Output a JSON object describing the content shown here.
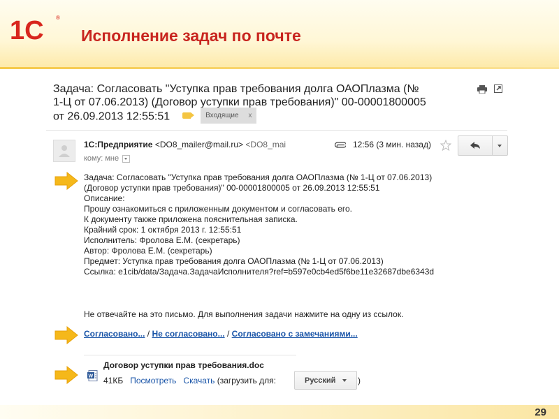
{
  "slide": {
    "title": "Исполнение задач по почте",
    "page_number": "29",
    "logo_text": "1С"
  },
  "email": {
    "subject_line1": "Задача: Согласовать \"Уступка прав требования долга ОАОПлазма (№",
    "subject_line2": "1-Ц от 07.06.2013) (Договор уступки прав требования)\" 00-00001800005",
    "subject_line3": "от 26.09.2013 12:55:51",
    "folder_label": "Входящие",
    "folder_remove": "x",
    "sender_name": "1С:Предприятие",
    "sender_email": "<DO8_mailer@mail.ru>",
    "sender_email_short": "<DO8_mai",
    "to_line": "кому: мне",
    "time": "12:56 (3 мин. назад)",
    "body_lines": [
      "Задача: Согласовать \"Уступка прав требования долга ОАОПлазма (№ 1-Ц от 07.06.2013)",
      "(Договор уступки прав требования)\" 00-00001800005 от 26.09.2013 12:55:51",
      "Описание:",
      "Прошу ознакомиться с приложенным документом и согласовать его.",
      "К документу также приложена пояснительная записка.",
      "Крайний срок: 1 октября 2013 г. 12:55:51",
      "Исполнитель: Фролова Е.М. (секретарь)",
      "Автор: Фролова Е.М. (секретарь)",
      "Предмет: Уступка прав требования долга ОАОПлазма (№ 1-Ц от 07.06.2013)",
      "Ссылка: e1cib/data/Задача.ЗадачаИсполнителя?ref=b597e0cb4ed5f6be11e32687dbe6343d"
    ],
    "notice": "Не отвечайте на это письмо. Для выполнения задачи нажмите на одну из ссылок.",
    "links": {
      "approved": "Согласовано...",
      "not_approved": "Не согласовано...",
      "approved_with_remarks": "Согласовано с замечаниями...",
      "separator": " / "
    },
    "attachment": {
      "name": "Договор уступки прав требования.doc",
      "size": "41КБ",
      "view": "Посмотреть",
      "download": "Скачать",
      "load_for": "(загрузить для:",
      "language": "Русский",
      "close_paren": ")"
    }
  },
  "colors": {
    "title_red": "#c8251f",
    "link_blue": "#1a55a8",
    "arrow_yellow": "#f5b81a",
    "header_yellow": "#fde9a8"
  },
  "icons": [
    "print-icon",
    "popout-icon",
    "label-icon",
    "paperclip-icon",
    "star-icon",
    "reply-icon",
    "dropdown-icon",
    "word-doc-icon",
    "arrow-pointer-icon"
  ]
}
